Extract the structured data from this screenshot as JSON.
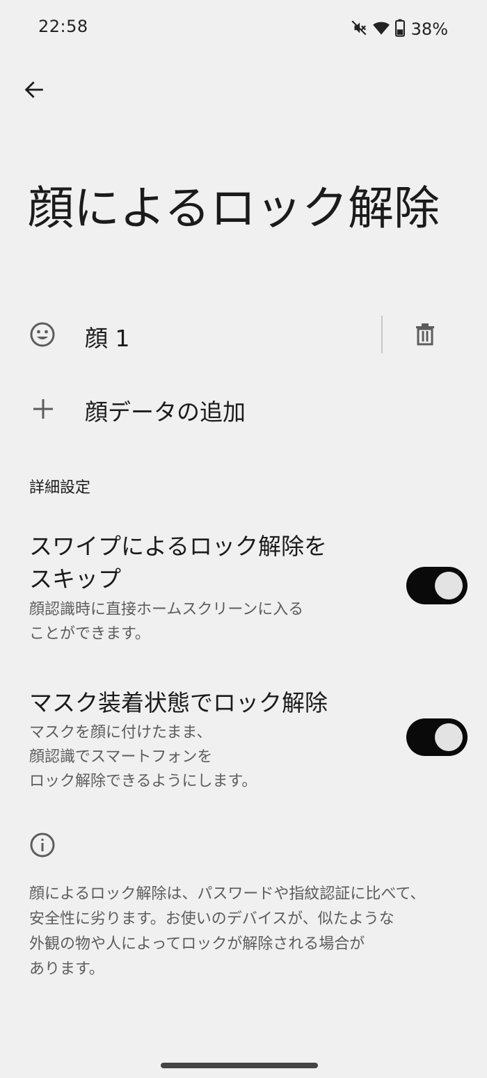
{
  "status_bar": {
    "time": "22:58",
    "battery_percent": "38%",
    "icons": [
      "mute-icon",
      "wifi-icon",
      "battery-icon"
    ]
  },
  "header": {
    "back_icon": "arrow-left-icon",
    "title": "顔によるロック解除"
  },
  "faces": {
    "items": [
      {
        "label": "顔 1",
        "icon": "face-icon",
        "action_icon": "trash-icon"
      }
    ],
    "add_label": "顔データの追加",
    "add_icon": "plus-icon"
  },
  "advanced": {
    "header": "詳細設定",
    "toggles": [
      {
        "title_lines": [
          "スワイプによるロック解除を",
          "スキップ"
        ],
        "summary_lines": [
          "顔認識時に直接ホームスクリーンに入る",
          "ことができます。"
        ],
        "checked": true
      },
      {
        "title_lines": [
          "マスク装着状態でロック解除"
        ],
        "summary_lines": [
          "マスクを顔に付けたまま、",
          "顔認識でスマートフォンを",
          "ロック解除できるようにします。"
        ],
        "checked": true
      }
    ]
  },
  "footer": {
    "icon": "info-icon",
    "lines": [
      "顔によるロック解除は、パスワードや指紋認証に比べて、",
      "安全性に劣ります。お使いのデバイスが、似たような",
      "外観の物や人によってロックが解除される場合が",
      "あります。"
    ]
  },
  "colors": {
    "background": "#f0f0f0",
    "switch_track_on": "#0a0a0a",
    "switch_thumb": "#e3e3e3",
    "secondary_text": "#5c5c5c"
  }
}
